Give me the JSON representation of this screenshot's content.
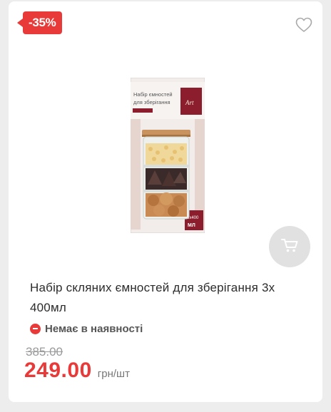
{
  "badge": {
    "discount": "-35%"
  },
  "product": {
    "title": "Набір скляних ємностей для зберігання 3х 400мл",
    "availability": "Немає в наявності",
    "box_text": {
      "line1": "Набір ємностей",
      "line2": "для зберігання",
      "brand": "Art",
      "volume": "3х400",
      "volume_unit": "МЛ"
    }
  },
  "price": {
    "old": "385.00",
    "current": "249.00",
    "unit": "грн/шт"
  },
  "icons": {
    "wishlist": "heart-outline-icon",
    "cart": "cart-icon",
    "availability": "minus-circle-icon"
  },
  "colors": {
    "accent": "#e93a3a",
    "cart_button_bg": "#e1e1e1",
    "page_bg": "#ededed"
  }
}
